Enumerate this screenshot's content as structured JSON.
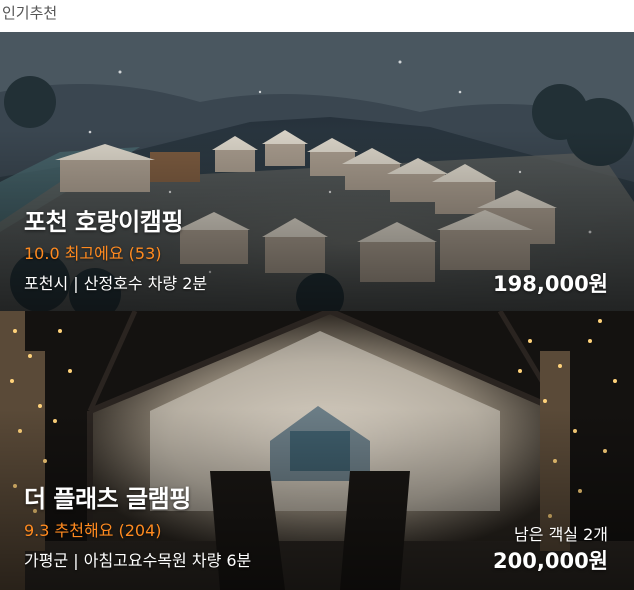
{
  "section": {
    "title": "인기추천"
  },
  "cards": [
    {
      "name": "포천 호랑이캠핑",
      "rating": "10.0 최고에요 (53)",
      "location": "포천시 | 산정호수 차량 2분",
      "price": "198,000원",
      "image": "snowy-glamping-site-photo"
    },
    {
      "name": "더 플래츠 글램핑",
      "rating": "9.3 추천해요 (204)",
      "location": "가평군 | 아침고요수목원 차량 6분",
      "remaining": "남은 객실 2개",
      "price": "200,000원",
      "image": "lit-glamping-tent-night-photo"
    }
  ],
  "colors": {
    "rating": "#ff8a1f",
    "text": "#ffffff",
    "section_title": "#555555"
  }
}
